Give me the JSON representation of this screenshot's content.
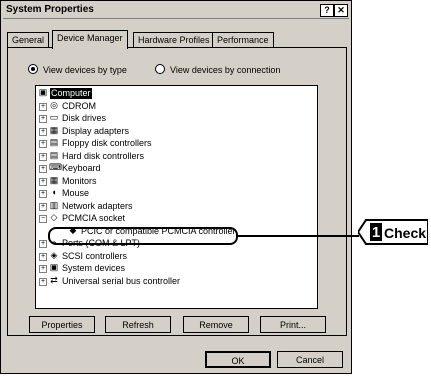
{
  "window": {
    "title": "System Properties",
    "help_btn": "?",
    "close_btn": "✕"
  },
  "tabs": [
    {
      "label": "General"
    },
    {
      "label": "Device Manager"
    },
    {
      "label": "Hardware Profiles"
    },
    {
      "label": "Performance"
    }
  ],
  "view": {
    "by_type": "View devices by type",
    "by_connection": "View devices by connection",
    "selected": "View devices by type"
  },
  "tree": [
    {
      "label": "Computer",
      "icon": "computer-icon",
      "expander": ""
    },
    {
      "label": "CDROM",
      "icon": "cdrom-icon",
      "expander": "+"
    },
    {
      "label": "Disk drives",
      "icon": "disk-drive-icon",
      "expander": "+"
    },
    {
      "label": "Display adapters",
      "icon": "display-icon",
      "expander": "+"
    },
    {
      "label": "Floppy disk controllers",
      "icon": "floppy-icon",
      "expander": "+"
    },
    {
      "label": "Hard disk controllers",
      "icon": "hdd-icon",
      "expander": "+"
    },
    {
      "label": "Keyboard",
      "icon": "keyboard-icon",
      "expander": "+"
    },
    {
      "label": "Monitors",
      "icon": "monitor-icon",
      "expander": "+"
    },
    {
      "label": "Mouse",
      "icon": "mouse-icon",
      "expander": "+"
    },
    {
      "label": "Network adapters",
      "icon": "network-icon",
      "expander": "+"
    },
    {
      "label": "PCMCIA socket",
      "icon": "pcmcia-icon",
      "expander": "-"
    },
    {
      "label": "PCIC or compatible PCMCIA controller",
      "icon": "pcmcia-card-icon",
      "expander": ""
    },
    {
      "label": "Ports (COM & LPT)",
      "icon": "port-icon",
      "expander": "+"
    },
    {
      "label": "SCSI controllers",
      "icon": "scsi-icon",
      "expander": "+"
    },
    {
      "label": "System devices",
      "icon": "system-icon",
      "expander": "+"
    },
    {
      "label": "Universal serial bus controller",
      "icon": "usb-icon",
      "expander": "+"
    }
  ],
  "buttons": {
    "properties": "Properties",
    "refresh": "Refresh",
    "remove": "Remove",
    "print": "Print...",
    "ok": "OK",
    "cancel": "Cancel"
  },
  "callout": {
    "number": "1",
    "text": "Check"
  }
}
